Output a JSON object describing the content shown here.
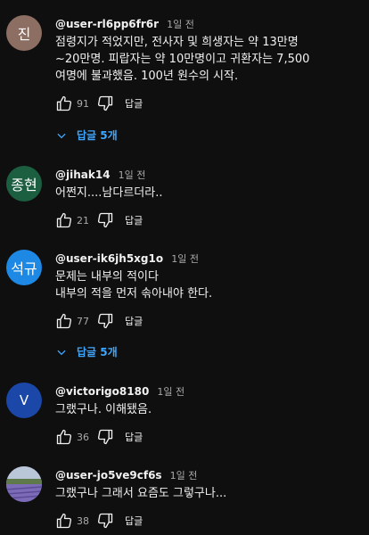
{
  "comments": [
    {
      "avatar_text": "진",
      "avatar_color": "#8d6e63",
      "author": "@user-rl6pp6fr6r",
      "time": "1일 전",
      "text": "점령지가 적었지만, 전사자 및 희생자는 약 13만명\n~20만명. 피랍자는 약 10만명이고 귀환자는 7,500\n여명에 불과했음. 100년 원수의 시작.",
      "likes": "91",
      "reply_label": "답글",
      "replies_label": "답글 5개"
    },
    {
      "avatar_text": "종현",
      "avatar_color": "#1b5e40",
      "author": "@jihak14",
      "time": "1일 전",
      "text": "어쩐지....남다르더라..",
      "likes": "21",
      "reply_label": "답글"
    },
    {
      "avatar_text": "석규",
      "avatar_color": "#1e88e5",
      "author": "@user-ik6jh5xg1o",
      "time": "1일 전",
      "text": "문제는 내부의 적이다\n내부의 적을 먼저 솎아내야 한다.",
      "likes": "77",
      "reply_label": "답글",
      "replies_label": "답글 5개"
    },
    {
      "avatar_text": "V",
      "avatar_color": "#1a47a8",
      "author": "@victorigo8180",
      "time": "1일 전",
      "text": "그랬구나. 이해됐음.",
      "likes": "36",
      "reply_label": "답글"
    },
    {
      "avatar_text": "",
      "avatar_color": "#7d78b5",
      "author": "@user-jo5ve9cf6s",
      "time": "1일 전",
      "text": "그랬구나 그래서  요즘도  그렇구나...",
      "likes": "38",
      "reply_label": "답글"
    }
  ],
  "icons": {
    "like": "thumbs-up-icon",
    "dislike": "thumbs-down-icon",
    "expand": "chevron-down-icon"
  },
  "colors": {
    "background": "#0f0f0f",
    "link_blue": "#3ea6ff",
    "secondary_text": "#aaaaaa"
  }
}
